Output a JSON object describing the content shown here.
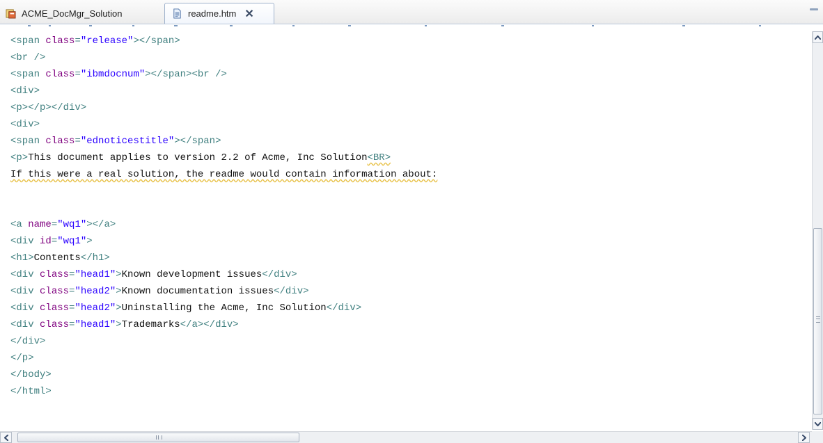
{
  "tabs": [
    {
      "label": "ACME_DocMgr_Solution",
      "icon": "project-icon",
      "active": false
    },
    {
      "label": "readme.htm",
      "icon": "html-file-icon",
      "active": true,
      "close_icon": "close-icon"
    }
  ],
  "window_controls": {
    "minimize_icon": "minimize-icon"
  },
  "editor": {
    "lines": [
      [
        {
          "t": "tag",
          "v": "<span "
        },
        {
          "t": "attr",
          "v": "class"
        },
        {
          "t": "tag",
          "v": "="
        },
        {
          "t": "str",
          "v": "\"release\""
        },
        {
          "t": "tag",
          "v": "></span>"
        }
      ],
      [
        {
          "t": "tag",
          "v": "<br />"
        }
      ],
      [
        {
          "t": "tag",
          "v": "<span "
        },
        {
          "t": "attr",
          "v": "class"
        },
        {
          "t": "tag",
          "v": "="
        },
        {
          "t": "str",
          "v": "\"ibmdocnum\""
        },
        {
          "t": "tag",
          "v": "></span><br />"
        }
      ],
      [
        {
          "t": "tag",
          "v": "<div>"
        }
      ],
      [
        {
          "t": "tag",
          "v": "<p></p></div>"
        }
      ],
      [
        {
          "t": "tag",
          "v": "<div>"
        }
      ],
      [
        {
          "t": "tag",
          "v": "<span "
        },
        {
          "t": "attr",
          "v": "class"
        },
        {
          "t": "tag",
          "v": "="
        },
        {
          "t": "str",
          "v": "\"ednoticestitle\""
        },
        {
          "t": "tag",
          "v": "></span>"
        }
      ],
      [
        {
          "t": "tag",
          "v": "<p>"
        },
        {
          "t": "txt",
          "v": "This document applies to version 2.2 of Acme, Inc Solution"
        },
        {
          "t": "tag squiggle",
          "v": "<BR>"
        }
      ],
      [
        {
          "t": "txt squiggle",
          "v": "If this were a real solution, the readme would contain information about:"
        }
      ],
      [],
      [],
      [
        {
          "t": "tag",
          "v": "<a "
        },
        {
          "t": "attr",
          "v": "name"
        },
        {
          "t": "tag",
          "v": "="
        },
        {
          "t": "str",
          "v": "\"wq1\""
        },
        {
          "t": "tag",
          "v": "></a>"
        }
      ],
      [
        {
          "t": "tag",
          "v": "<div "
        },
        {
          "t": "attr",
          "v": "id"
        },
        {
          "t": "tag",
          "v": "="
        },
        {
          "t": "str",
          "v": "\"wq1\""
        },
        {
          "t": "tag",
          "v": ">"
        }
      ],
      [
        {
          "t": "tag",
          "v": "<h1>"
        },
        {
          "t": "txt",
          "v": "Contents"
        },
        {
          "t": "tag",
          "v": "</h1>"
        }
      ],
      [
        {
          "t": "tag",
          "v": "<div "
        },
        {
          "t": "attr",
          "v": "class"
        },
        {
          "t": "tag",
          "v": "="
        },
        {
          "t": "str",
          "v": "\"head1\""
        },
        {
          "t": "tag",
          "v": ">"
        },
        {
          "t": "txt",
          "v": "Known development issues"
        },
        {
          "t": "tag",
          "v": "</div>"
        }
      ],
      [
        {
          "t": "tag",
          "v": "<div "
        },
        {
          "t": "attr",
          "v": "class"
        },
        {
          "t": "tag",
          "v": "="
        },
        {
          "t": "str",
          "v": "\"head2\""
        },
        {
          "t": "tag",
          "v": ">"
        },
        {
          "t": "txt",
          "v": "Known documentation issues"
        },
        {
          "t": "tag",
          "v": "</div>"
        }
      ],
      [
        {
          "t": "tag",
          "v": "<div "
        },
        {
          "t": "attr",
          "v": "class"
        },
        {
          "t": "tag",
          "v": "="
        },
        {
          "t": "str",
          "v": "\"head2\""
        },
        {
          "t": "tag",
          "v": ">"
        },
        {
          "t": "txt",
          "v": "Uninstalling the Acme, Inc Solution"
        },
        {
          "t": "tag",
          "v": "</div>"
        }
      ],
      [
        {
          "t": "tag",
          "v": "<div "
        },
        {
          "t": "attr",
          "v": "class"
        },
        {
          "t": "tag",
          "v": "="
        },
        {
          "t": "str",
          "v": "\"head1\""
        },
        {
          "t": "tag",
          "v": ">"
        },
        {
          "t": "txt",
          "v": "Trademarks"
        },
        {
          "t": "tag",
          "v": "</a></div>"
        }
      ],
      [
        {
          "t": "tag",
          "v": "</div>"
        }
      ],
      [
        {
          "t": "tag",
          "v": "</p>"
        }
      ],
      [
        {
          "t": "tag",
          "v": "</body>"
        }
      ],
      [
        {
          "t": "tag",
          "v": "</html>"
        }
      ]
    ]
  },
  "scrollbars": {
    "vertical": {
      "up_icon": "arrow-up-icon",
      "down_icon": "arrow-down-icon"
    },
    "horizontal": {
      "left_icon": "arrow-left-icon",
      "right_icon": "arrow-right-icon"
    }
  },
  "colors": {
    "tag": "#3f7f7f",
    "attribute": "#7f007f",
    "string": "#2a00ff",
    "text": "#111111",
    "spell_underline": "#e8c24a"
  }
}
